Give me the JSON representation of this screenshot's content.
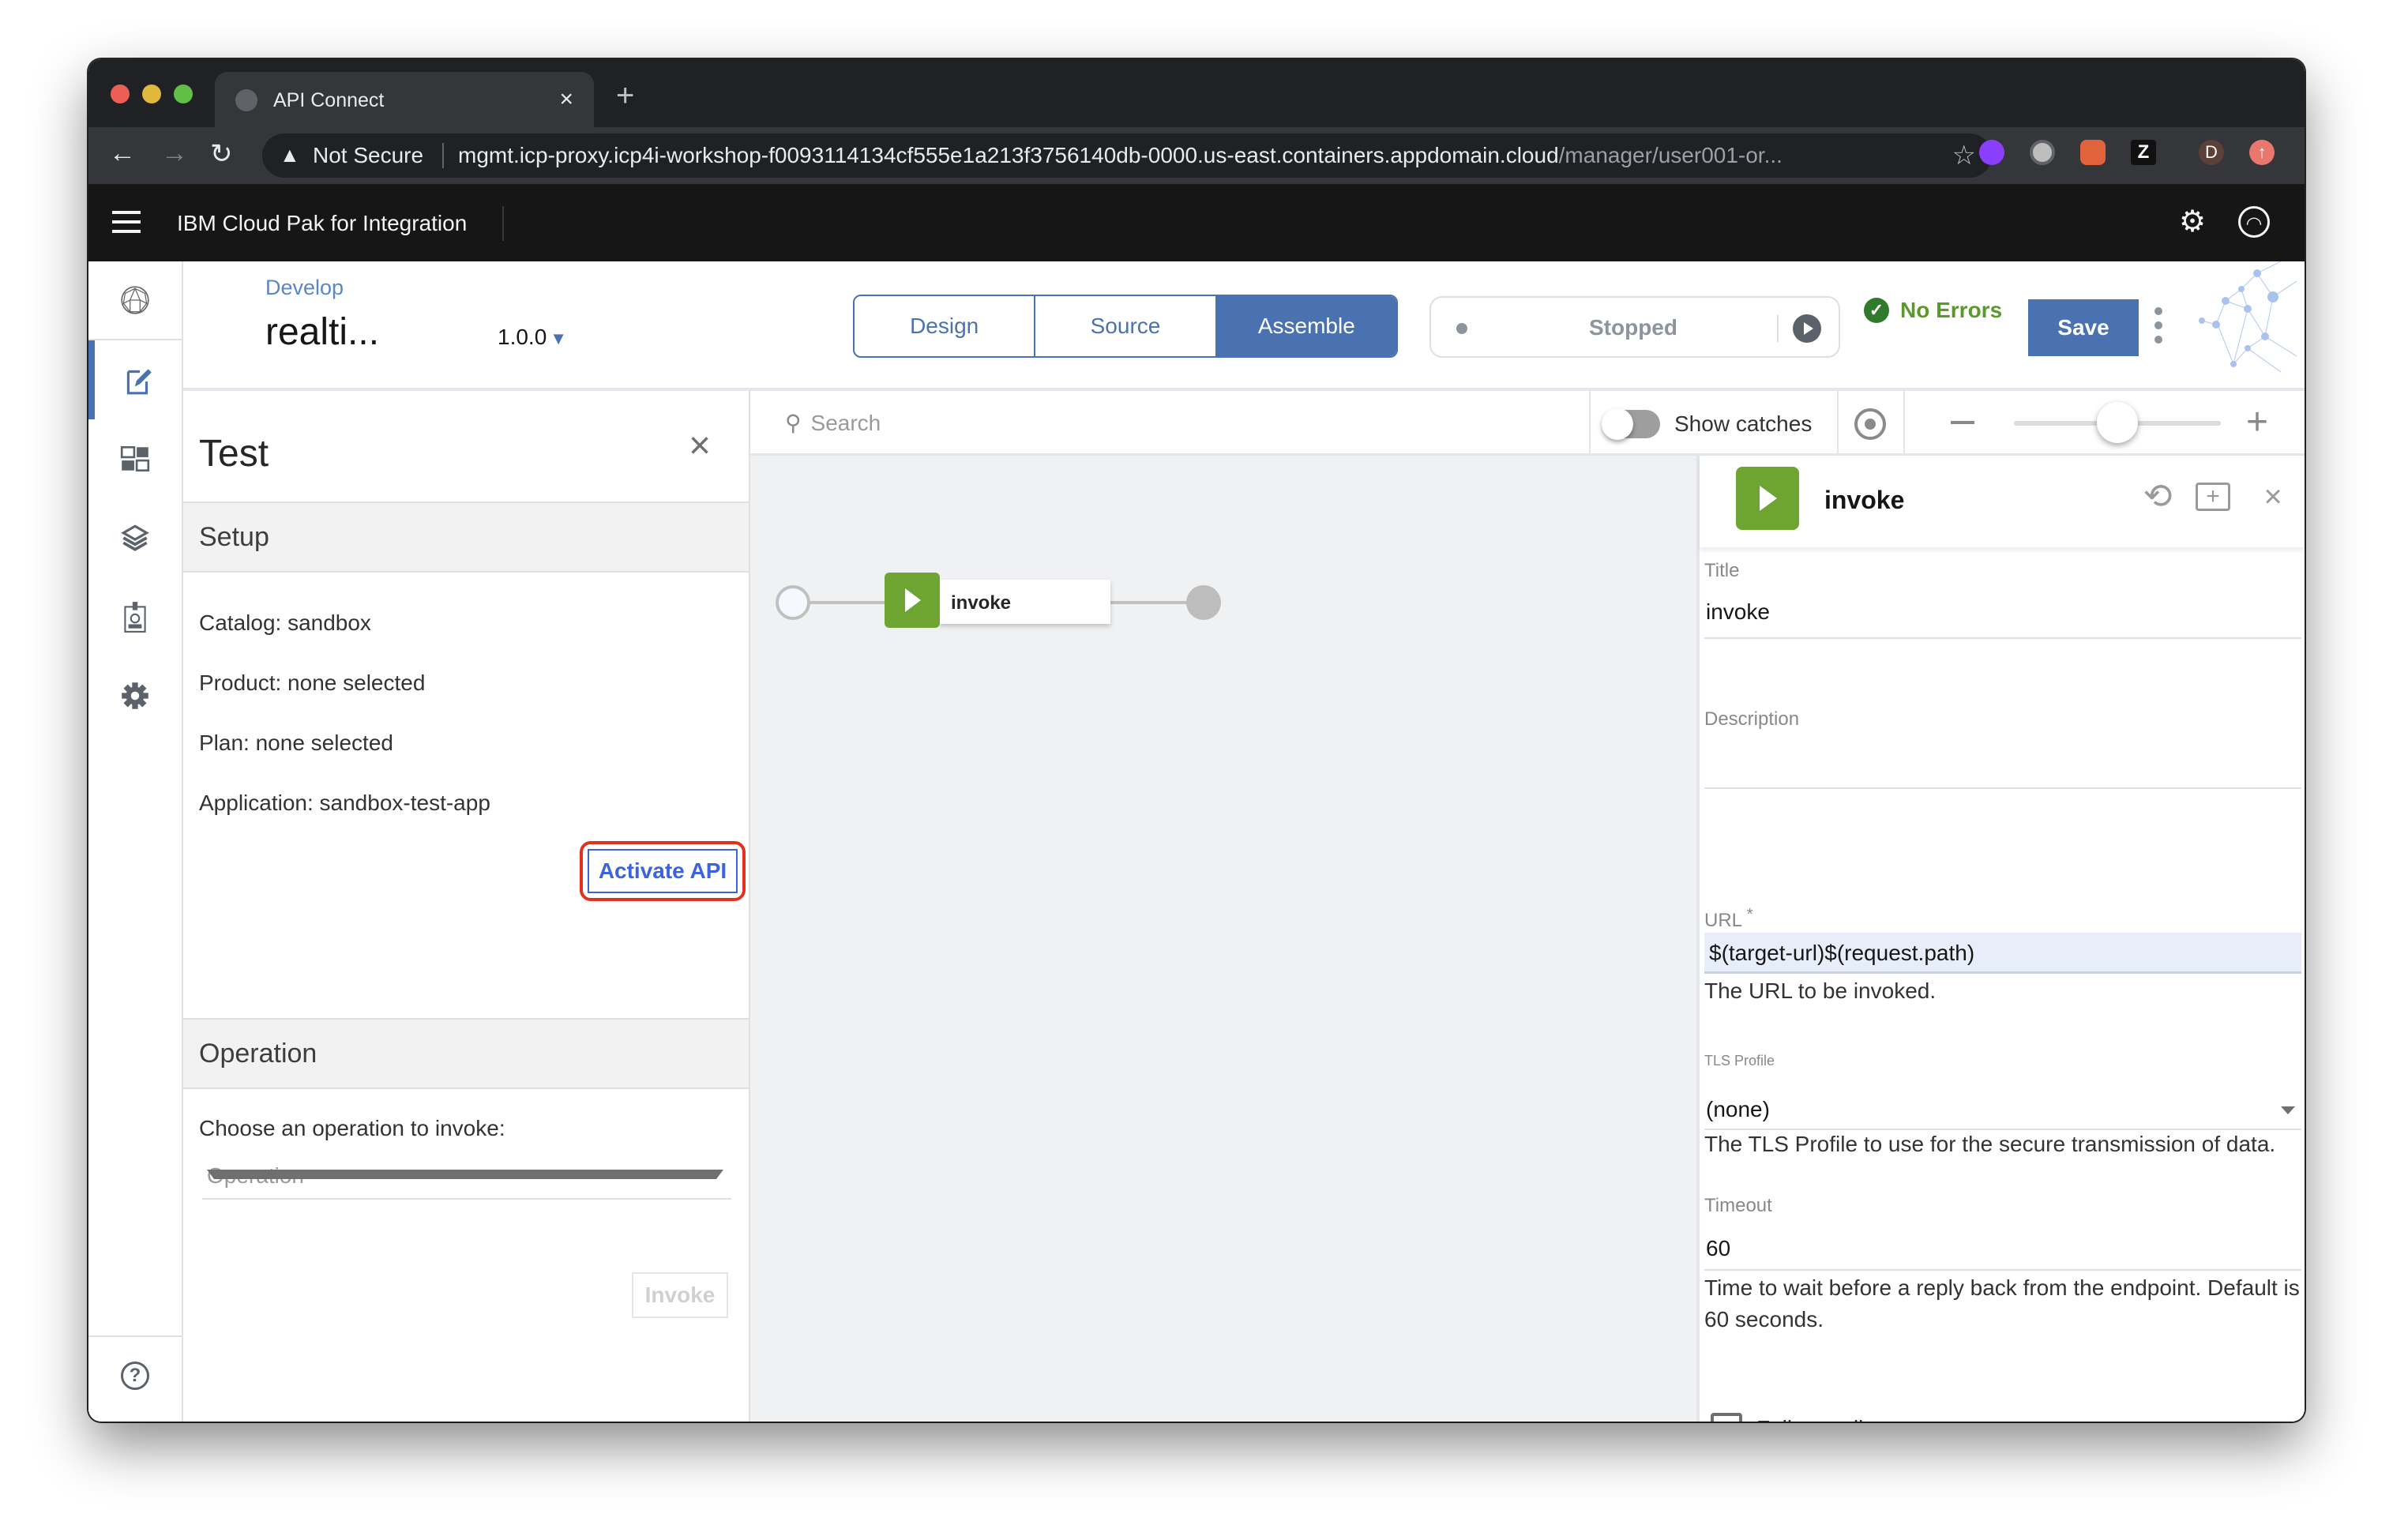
{
  "browser": {
    "tab_title": "API Connect",
    "new_tab_label": "+",
    "security_label": "Not Secure",
    "url_host": "mgmt.icp-proxy.icp4i-workshop-f0093114134cf555e1a213f3756140db-0000.us-east.containers.appdomain.cloud",
    "url_path": "/manager/user001-or...",
    "profile_initial": "D",
    "extension_z": "Z"
  },
  "app_header": {
    "brand": "IBM Cloud Pak for Integration"
  },
  "topbar": {
    "breadcrumb": "Develop",
    "api_title": "realti...",
    "version": "1.0.0",
    "tabs": [
      {
        "label": "Design",
        "active": false
      },
      {
        "label": "Source",
        "active": false
      },
      {
        "label": "Assemble",
        "active": true
      }
    ],
    "status": "Stopped",
    "validation": "No Errors",
    "save_label": "Save"
  },
  "test_panel": {
    "title": "Test",
    "setup_heading": "Setup",
    "catalog": "Catalog: sandbox",
    "product": "Product: none selected",
    "plan": "Plan: none selected",
    "application": "Application: sandbox-test-app",
    "activate_label": "Activate API",
    "operation_heading": "Operation",
    "operation_prompt": "Choose an operation to invoke:",
    "operation_placeholder": "Operation",
    "invoke_label": "Invoke"
  },
  "canvas_toolbar": {
    "search_placeholder": "Search",
    "show_catches_label": "Show catches",
    "show_catches_on": false,
    "zoom_level": 0.5
  },
  "flow": {
    "node_label": "invoke"
  },
  "properties": {
    "title": "invoke",
    "fields": {
      "title_label": "Title",
      "title_value": "invoke",
      "description_label": "Description",
      "description_value": "",
      "url_label": "URL",
      "url_required": "*",
      "url_value": "$(target-url)$(request.path)",
      "url_help": "The URL to be invoked.",
      "tls_label": "TLS Profile",
      "tls_value": "(none)",
      "tls_help": "The TLS Profile to use for the secure transmission of data.",
      "timeout_label": "Timeout",
      "timeout_value": "60",
      "timeout_help": "Time to wait before a reply back from the endpoint. Default is 60 seconds.",
      "follow_redirects_label": "Follow redirects",
      "follow_redirects_checked": false
    }
  },
  "colors": {
    "accent": "#4a72b0",
    "invoke_green": "#6ea431",
    "success_green": "#5a9a2c",
    "highlight_red": "#e2321f"
  }
}
